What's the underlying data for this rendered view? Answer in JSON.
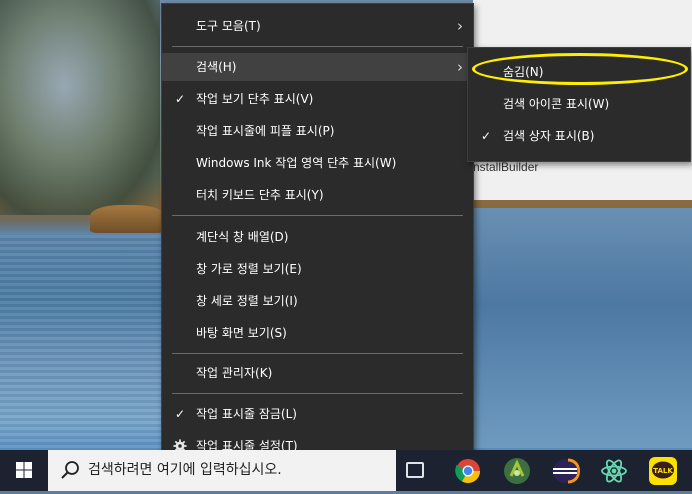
{
  "background_window": {
    "text": "nstallBuilder"
  },
  "main_menu": {
    "items": [
      {
        "label": "도구 모음(T)",
        "checked": false,
        "submenu": true
      },
      {
        "label": "검색(H)",
        "checked": false,
        "submenu": true,
        "highlighted": true
      },
      {
        "label": "작업 보기 단추 표시(V)",
        "checked": true,
        "check_glyph": "✓"
      },
      {
        "label": "작업 표시줄에 피플 표시(P)",
        "checked": false
      },
      {
        "label": "Windows Ink 작업 영역 단추 표시(W)",
        "checked": false
      },
      {
        "label": "터치 키보드 단추 표시(Y)",
        "checked": false
      },
      {
        "label": "계단식 창 배열(D)",
        "checked": false
      },
      {
        "label": "창 가로 정렬 보기(E)",
        "checked": false
      },
      {
        "label": "창 세로 정렬 보기(I)",
        "checked": false
      },
      {
        "label": "바탕 화면 보기(S)",
        "checked": false
      },
      {
        "label": "작업 관리자(K)",
        "checked": false
      },
      {
        "label": "작업 표시줄 잠금(L)",
        "checked": true,
        "check_glyph": "✓"
      },
      {
        "label": "작업 표시줄 설정(T)",
        "checked": false,
        "icon": "gear-icon"
      }
    ],
    "arrow_glyph": "›"
  },
  "search_submenu": {
    "items": [
      {
        "label": "숨김(N)",
        "checked": false,
        "annotated": true
      },
      {
        "label": "검색 아이콘 표시(W)",
        "checked": false
      },
      {
        "label": "검색 상자 표시(B)",
        "checked": true,
        "check_glyph": "✓"
      }
    ],
    "annotation_color": "#ffee00"
  },
  "taskbar": {
    "search_placeholder": "검색하려면 여기에 입력하십시오.",
    "icons": [
      "windows-start-icon",
      "search-icon",
      "task-view-icon",
      "chrome-icon",
      "android-studio-icon",
      "eclipse-icon",
      "atom-icon",
      "kakaotalk-icon"
    ],
    "kakaotalk_label": "TALK",
    "colors": {
      "taskbar": "#1c2230",
      "menu": "#2b2b2b",
      "menu_highlight": "#414141"
    }
  }
}
